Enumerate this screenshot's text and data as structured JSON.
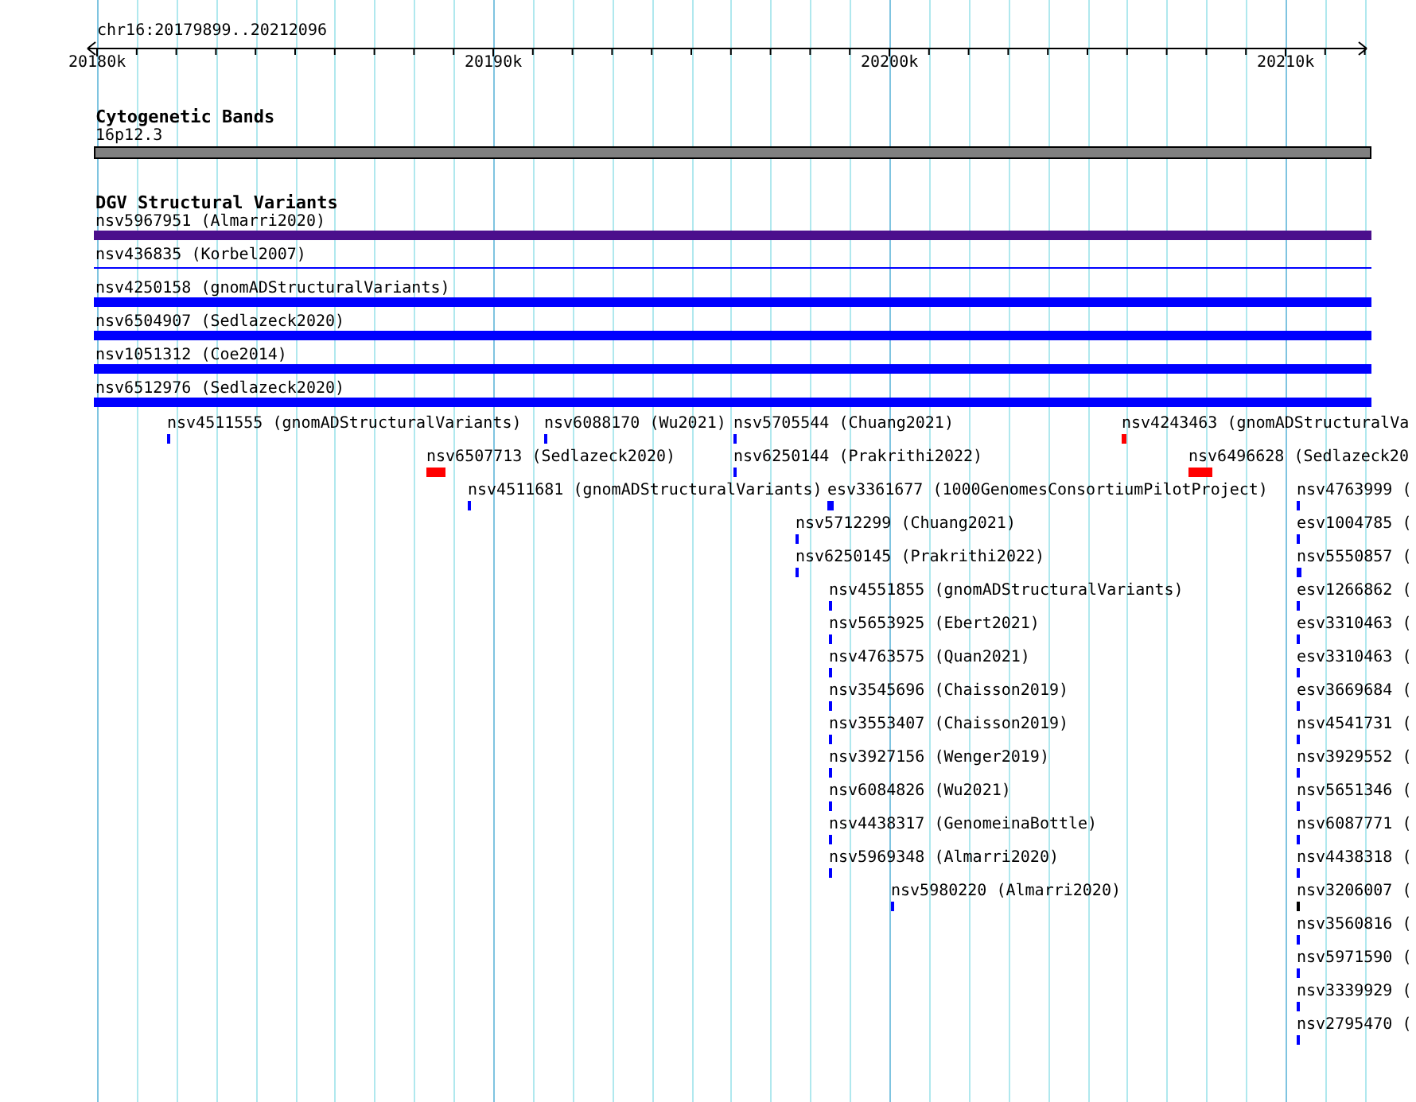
{
  "location": "chr16:20179899..20212096",
  "ruler": {
    "ticks": [
      "20180k",
      "20190k",
      "20200k",
      "20210k"
    ]
  },
  "tracks": [
    {
      "title": "Cytogenetic Bands",
      "features": [
        {
          "label": "16p12.3",
          "kind": "band",
          "color": "#808080"
        }
      ]
    },
    {
      "title": "DGV Structural Variants",
      "features": [
        {
          "label": "nsv5967951 (Almarri2020)",
          "kind": "bar",
          "color": "#4b0f8c"
        },
        {
          "label": "nsv436835 (Korbel2007)",
          "kind": "line",
          "color": "#0000ff"
        },
        {
          "label": "nsv4250158 (gnomADStructuralVariants)",
          "kind": "bar",
          "color": "#0000ff"
        },
        {
          "label": "nsv6504907 (Sedlazeck2020)",
          "kind": "bar",
          "color": "#0000ff"
        },
        {
          "label": "nsv1051312 (Coe2014)",
          "kind": "bar",
          "color": "#0000ff"
        },
        {
          "label": "nsv6512976 (Sedlazeck2020)",
          "kind": "bar",
          "color": "#0000ff"
        },
        {
          "label": "nsv4511555 (gnomADStructuralVariants)",
          "kind": "tick",
          "color": "#0000ff"
        },
        {
          "label": "nsv6088170 (Wu2021)",
          "kind": "tick",
          "color": "#0000ff"
        },
        {
          "label": "nsv5705544 (Chuang2021)",
          "kind": "tick",
          "color": "#0000ff"
        },
        {
          "label": "nsv4243463 (gnomADStructuralVa",
          "kind": "tick",
          "color": "#ff0000"
        },
        {
          "label": "nsv6507713 (Sedlazeck2020)",
          "kind": "tick",
          "color": "#ff0000"
        },
        {
          "label": "nsv6250144 (Prakrithi2022)",
          "kind": "tick",
          "color": "#0000ff"
        },
        {
          "label": "nsv6496628 (Sedlazeck20",
          "kind": "tick",
          "color": "#ff0000"
        },
        {
          "label": "nsv4511681 (gnomADStructuralVariants)",
          "kind": "tick",
          "color": "#0000ff"
        },
        {
          "label": "esv3361677 (1000GenomesConsortiumPilotProject)",
          "kind": "tick",
          "color": "#0000ff"
        },
        {
          "label": "nsv4763999 (",
          "kind": "tick",
          "color": "#0000ff"
        },
        {
          "label": "nsv5712299 (Chuang2021)",
          "kind": "tick",
          "color": "#0000ff"
        },
        {
          "label": "esv1004785 (",
          "kind": "tick",
          "color": "#0000ff"
        },
        {
          "label": "nsv6250145 (Prakrithi2022)",
          "kind": "tick",
          "color": "#0000ff"
        },
        {
          "label": "nsv5550857 (",
          "kind": "tick",
          "color": "#0000ff"
        },
        {
          "label": "nsv4551855 (gnomADStructuralVariants)",
          "kind": "tick",
          "color": "#0000ff"
        },
        {
          "label": "esv1266862 (",
          "kind": "tick",
          "color": "#0000ff"
        },
        {
          "label": "nsv5653925 (Ebert2021)",
          "kind": "tick",
          "color": "#0000ff"
        },
        {
          "label": "esv3310463 (",
          "kind": "tick",
          "color": "#0000ff"
        },
        {
          "label": "nsv4763575 (Quan2021)",
          "kind": "tick",
          "color": "#0000ff"
        },
        {
          "label": "esv3310463 (",
          "kind": "tick",
          "color": "#0000ff"
        },
        {
          "label": "nsv3545696 (Chaisson2019)",
          "kind": "tick",
          "color": "#0000ff"
        },
        {
          "label": "esv3669684 (",
          "kind": "tick",
          "color": "#0000ff"
        },
        {
          "label": "nsv3553407 (Chaisson2019)",
          "kind": "tick",
          "color": "#0000ff"
        },
        {
          "label": "nsv4541731 (",
          "kind": "tick",
          "color": "#0000ff"
        },
        {
          "label": "nsv3927156 (Wenger2019)",
          "kind": "tick",
          "color": "#0000ff"
        },
        {
          "label": "nsv3929552 (",
          "kind": "tick",
          "color": "#0000ff"
        },
        {
          "label": "nsv6084826 (Wu2021)",
          "kind": "tick",
          "color": "#0000ff"
        },
        {
          "label": "nsv5651346 (",
          "kind": "tick",
          "color": "#0000ff"
        },
        {
          "label": "nsv4438317 (GenomeinaBottle)",
          "kind": "tick",
          "color": "#0000ff"
        },
        {
          "label": "nsv6087771 (",
          "kind": "tick",
          "color": "#0000ff"
        },
        {
          "label": "nsv5969348 (Almarri2020)",
          "kind": "tick",
          "color": "#0000ff"
        },
        {
          "label": "nsv4438318 (",
          "kind": "tick",
          "color": "#0000ff"
        },
        {
          "label": "nsv5980220 (Almarri2020)",
          "kind": "tick",
          "color": "#0000ff"
        },
        {
          "label": "nsv3206007 (",
          "kind": "tick",
          "color": "#000000"
        },
        {
          "label": "nsv3560816 (",
          "kind": "tick",
          "color": "#0000ff"
        },
        {
          "label": "nsv5971590 (",
          "kind": "tick",
          "color": "#0000ff"
        },
        {
          "label": "nsv3339929 (",
          "kind": "tick",
          "color": "#0000ff"
        },
        {
          "label": "nsv2795470 (",
          "kind": "tick",
          "color": "#0000ff"
        }
      ]
    }
  ]
}
